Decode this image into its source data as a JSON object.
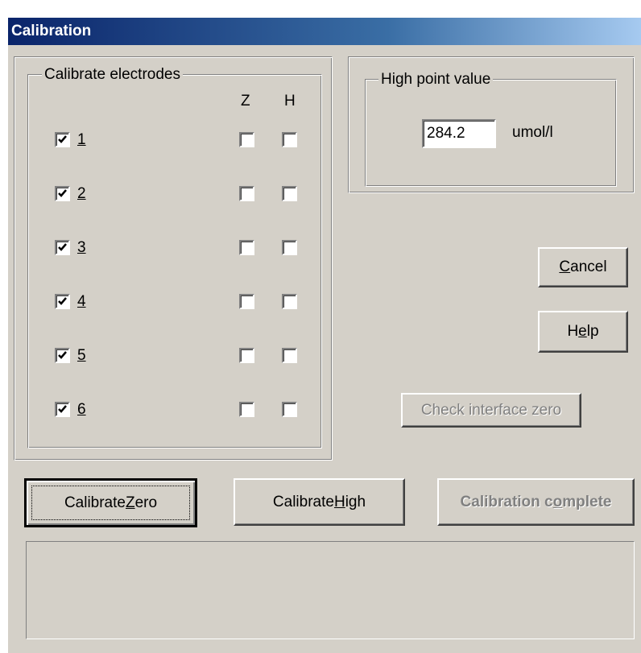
{
  "window": {
    "title": "Calibration"
  },
  "electrodes": {
    "legend": "Calibrate electrodes",
    "col_z": "Z",
    "col_h": "H",
    "rows": [
      {
        "label": "1",
        "checked": true,
        "z": false,
        "h": false
      },
      {
        "label": "2",
        "checked": true,
        "z": false,
        "h": false
      },
      {
        "label": "3",
        "checked": true,
        "z": false,
        "h": false
      },
      {
        "label": "4",
        "checked": true,
        "z": false,
        "h": false
      },
      {
        "label": "5",
        "checked": true,
        "z": false,
        "h": false
      },
      {
        "label": "6",
        "checked": true,
        "z": false,
        "h": false
      }
    ]
  },
  "high_point": {
    "legend": "High point value",
    "value": "284.2",
    "unit": "umol/l"
  },
  "buttons": {
    "cancel": {
      "pre": "",
      "key": "C",
      "post": "ancel"
    },
    "help": {
      "pre": "H",
      "key": "e",
      "post": "lp"
    },
    "check_zero": "Check interface zero",
    "cal_zero": {
      "pre": "Calibrate ",
      "key": "Z",
      "post": "ero"
    },
    "cal_high": {
      "pre": "Calibrate ",
      "key": "H",
      "post": "igh"
    },
    "cal_complete": {
      "pre": "Calibration c",
      "key": "o",
      "post": "mplete"
    }
  },
  "status": {
    "text": ""
  },
  "colors": {
    "face": "#d4d0c8",
    "title_start": "#0a246a",
    "title_end": "#a6caf0",
    "disabled": "#808080"
  }
}
